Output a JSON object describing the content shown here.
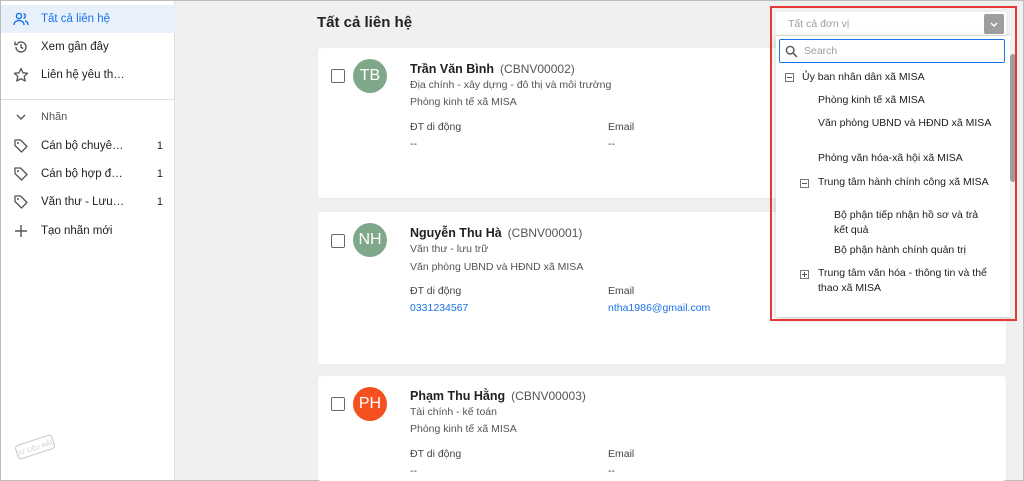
{
  "sidebar": {
    "items": [
      {
        "label": "Tất cả liên hệ",
        "icon": "people-icon"
      },
      {
        "label": "Xem gần đây",
        "icon": "history-icon"
      },
      {
        "label": "Liên hệ yêu thích",
        "icon": "star-icon"
      }
    ],
    "labels_section": {
      "label": "Nhãn",
      "icon": "chevron-down-icon"
    },
    "label_items": [
      {
        "label": "Cán bộ chuyên ...",
        "count": "1",
        "icon": "tag-icon"
      },
      {
        "label": "Cán bộ hợp đồng",
        "count": "1",
        "icon": "tag-icon"
      },
      {
        "label": "Văn thư - Lưu trữ",
        "count": "1",
        "icon": "tag-icon"
      }
    ],
    "create_label": {
      "label": "Tạo nhãn mới",
      "icon": "plus-icon"
    },
    "watermark_text": "DỮ LIỆU MẪU"
  },
  "main": {
    "title": "Tất cả liên hệ",
    "contacts": [
      {
        "initials": "TB",
        "avatar_color": "#7fa88a",
        "name": "Trần Văn Bình",
        "code": "(CBNV00002)",
        "position": "Địa chính - xây dựng - đô thị và môi trường",
        "department": "Phòng kinh tế xã MISA",
        "phone_label": "ĐT di động",
        "phone": "--",
        "email_label": "Email",
        "email": "--"
      },
      {
        "initials": "NH",
        "avatar_color": "#7fa88a",
        "name": "Nguyễn Thu Hà",
        "code": "(CBNV00001)",
        "position": "Văn thư - lưu trữ",
        "department": "Văn phòng UBND và HĐND xã MISA",
        "phone_label": "ĐT di động",
        "phone": "0331234567",
        "email_label": "Email",
        "email": "ntha1986@gmail.com"
      },
      {
        "initials": "PH",
        "avatar_color": "#f4511e",
        "name": "Phạm Thu Hằng",
        "code": "(CBNV00003)",
        "position": "Tài chính - kế toán",
        "department": "Phòng kinh tế xã MISA",
        "phone_label": "ĐT di động",
        "phone": "--",
        "email_label": "Email",
        "email": "--"
      }
    ]
  },
  "unit_dropdown": {
    "placeholder": "Tất cả đơn vị",
    "search_placeholder": "Search",
    "tree": [
      {
        "label": "Ủy ban nhân dân xã MISA",
        "toggle": "−"
      },
      {
        "label": "Phòng kinh tế xã MISA"
      },
      {
        "label": "Văn phòng UBND và HĐND xã MISA"
      },
      {
        "label": "Phòng văn hóa-xã hội xã MISA"
      },
      {
        "label": "Trung tâm hành chính công xã MISA",
        "toggle": "−"
      },
      {
        "label": "Bộ phận tiếp nhận hồ sơ và trả kết quả"
      },
      {
        "label": "Bộ phận hành chính quản trị"
      },
      {
        "label": "Trung tâm văn hóa - thông tin và thể thao xã MISA",
        "toggle": "+"
      }
    ]
  },
  "colors": {
    "accent": "#1a73e8",
    "highlight_border": "#e53935",
    "active_bg": "#e8f0fb"
  }
}
